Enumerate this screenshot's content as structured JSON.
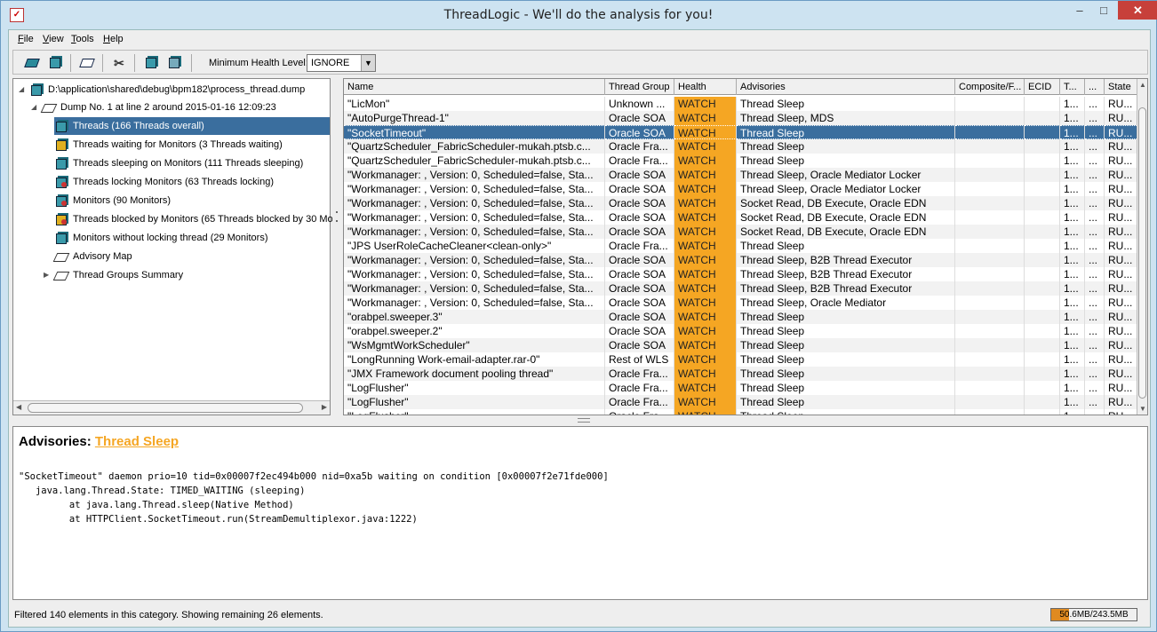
{
  "window": {
    "title": "ThreadLogic - We'll do the analysis for you!",
    "icon": "app-icon",
    "min": "‒",
    "max": "□",
    "close": "✕"
  },
  "menu": [
    {
      "label": "File",
      "u": "F",
      "rest": "ile"
    },
    {
      "label": "View",
      "u": "V",
      "rest": "iew"
    },
    {
      "label": "Tools",
      "u": "T",
      "rest": "ools"
    },
    {
      "label": "Help",
      "u": "H",
      "rest": "elp"
    }
  ],
  "toolbar": {
    "health_label": "Minimum Health Level:",
    "health_value": "IGNORE",
    "buttons": [
      "open-dump-icon",
      "open-cube-icon",
      "diamond-icon",
      "tools-icon",
      "cube-a-icon",
      "cube-b-icon"
    ]
  },
  "tree": {
    "root": "D:\\application\\shared\\debug\\bpm182\\process_thread.dump",
    "dump": "Dump No. 1 at line 2 around 2015-01-16 12:09:23",
    "items": [
      {
        "label": "Threads (166 Threads overall)",
        "selected": true
      },
      {
        "label": "Threads waiting for Monitors (3 Threads waiting)"
      },
      {
        "label": "Threads sleeping on Monitors (111 Threads sleeping)"
      },
      {
        "label": "Threads locking Monitors (63 Threads locking)"
      },
      {
        "label": "Monitors (90 Monitors)"
      },
      {
        "label": "Threads blocked by Monitors (65 Threads blocked by 30 Mo"
      },
      {
        "label": "Monitors without locking thread (29 Monitors)"
      },
      {
        "label": "Advisory Map"
      },
      {
        "label": "Thread Groups Summary"
      }
    ]
  },
  "table": {
    "columns": [
      "Name",
      "Thread Group",
      "Health",
      "Advisories",
      "Composite/F...",
      "ECID",
      "T...",
      "...",
      "State"
    ],
    "rows": [
      {
        "name": "\"LicMon\"",
        "group": "Unknown ...",
        "health": "WATCH",
        "adv": "Thread Sleep",
        "t": "1...",
        "dots": "...",
        "state": "RU..."
      },
      {
        "name": "\"AutoPurgeThread-1\"",
        "group": "Oracle SOA",
        "health": "WATCH",
        "adv": "Thread Sleep, MDS",
        "t": "1...",
        "dots": "...",
        "state": "RU..."
      },
      {
        "name": "\"SocketTimeout\"",
        "group": "Oracle SOA",
        "health": "WATCH",
        "adv": "Thread Sleep",
        "t": "1...",
        "dots": "...",
        "state": "RU...",
        "selected": true
      },
      {
        "name": "\"QuartzScheduler_FabricScheduler-mukah.ptsb.c...",
        "group": "Oracle Fra...",
        "health": "WATCH",
        "adv": "Thread Sleep",
        "t": "1...",
        "dots": "...",
        "state": "RU..."
      },
      {
        "name": "\"QuartzScheduler_FabricScheduler-mukah.ptsb.c...",
        "group": "Oracle Fra...",
        "health": "WATCH",
        "adv": "Thread Sleep",
        "t": "1...",
        "dots": "...",
        "state": "RU..."
      },
      {
        "name": "\"Workmanager: , Version: 0, Scheduled=false, Sta...",
        "group": "Oracle SOA",
        "health": "WATCH",
        "adv": "Thread Sleep, Oracle Mediator Locker",
        "t": "1...",
        "dots": "...",
        "state": "RU..."
      },
      {
        "name": "\"Workmanager: , Version: 0, Scheduled=false, Sta...",
        "group": "Oracle SOA",
        "health": "WATCH",
        "adv": "Thread Sleep, Oracle Mediator Locker",
        "t": "1...",
        "dots": "...",
        "state": "RU..."
      },
      {
        "name": "\"Workmanager: , Version: 0, Scheduled=false, Sta...",
        "group": "Oracle SOA",
        "health": "WATCH",
        "adv": "Socket Read, DB Execute, Oracle EDN",
        "t": "1...",
        "dots": "...",
        "state": "RU..."
      },
      {
        "name": "\"Workmanager: , Version: 0, Scheduled=false, Sta...",
        "group": "Oracle SOA",
        "health": "WATCH",
        "adv": "Socket Read, DB Execute, Oracle EDN",
        "t": "1...",
        "dots": "...",
        "state": "RU..."
      },
      {
        "name": "\"Workmanager: , Version: 0, Scheduled=false, Sta...",
        "group": "Oracle SOA",
        "health": "WATCH",
        "adv": "Socket Read, DB Execute, Oracle EDN",
        "t": "1...",
        "dots": "...",
        "state": "RU..."
      },
      {
        "name": "\"JPS UserRoleCacheCleaner<clean-only>\"",
        "group": "Oracle Fra...",
        "health": "WATCH",
        "adv": "Thread Sleep",
        "t": "1...",
        "dots": "...",
        "state": "RU..."
      },
      {
        "name": "\"Workmanager: , Version: 0, Scheduled=false, Sta...",
        "group": "Oracle SOA",
        "health": "WATCH",
        "adv": "Thread Sleep, B2B Thread Executor",
        "t": "1...",
        "dots": "...",
        "state": "RU..."
      },
      {
        "name": "\"Workmanager: , Version: 0, Scheduled=false, Sta...",
        "group": "Oracle SOA",
        "health": "WATCH",
        "adv": "Thread Sleep, B2B Thread Executor",
        "t": "1...",
        "dots": "...",
        "state": "RU..."
      },
      {
        "name": "\"Workmanager: , Version: 0, Scheduled=false, Sta...",
        "group": "Oracle SOA",
        "health": "WATCH",
        "adv": "Thread Sleep, B2B Thread Executor",
        "t": "1...",
        "dots": "...",
        "state": "RU..."
      },
      {
        "name": "\"Workmanager: , Version: 0, Scheduled=false, Sta...",
        "group": "Oracle SOA",
        "health": "WATCH",
        "adv": "Thread Sleep, Oracle Mediator",
        "t": "1...",
        "dots": "...",
        "state": "RU..."
      },
      {
        "name": "\"orabpel.sweeper.3\"",
        "group": "Oracle SOA",
        "health": "WATCH",
        "adv": "Thread Sleep",
        "t": "1...",
        "dots": "...",
        "state": "RU..."
      },
      {
        "name": "\"orabpel.sweeper.2\"",
        "group": "Oracle SOA",
        "health": "WATCH",
        "adv": "Thread Sleep",
        "t": "1...",
        "dots": "...",
        "state": "RU..."
      },
      {
        "name": "\"WsMgmtWorkScheduler\"",
        "group": "Oracle SOA",
        "health": "WATCH",
        "adv": "Thread Sleep",
        "t": "1...",
        "dots": "...",
        "state": "RU..."
      },
      {
        "name": "\"LongRunning Work-email-adapter.rar-0\"",
        "group": "Rest of WLS",
        "health": "WATCH",
        "adv": "Thread Sleep",
        "t": "1...",
        "dots": "...",
        "state": "RU..."
      },
      {
        "name": "\"JMX Framework document pooling thread\"",
        "group": "Oracle Fra...",
        "health": "WATCH",
        "adv": "Thread Sleep",
        "t": "1...",
        "dots": "...",
        "state": "RU..."
      },
      {
        "name": "\"LogFlusher\"",
        "group": "Oracle Fra...",
        "health": "WATCH",
        "adv": "Thread Sleep",
        "t": "1...",
        "dots": "...",
        "state": "RU..."
      },
      {
        "name": "\"LogFlusher\"",
        "group": "Oracle Fra...",
        "health": "WATCH",
        "adv": "Thread Sleep",
        "t": "1...",
        "dots": "...",
        "state": "RU..."
      },
      {
        "name": "\"LogFlusher\"",
        "group": "Oracle Fra...",
        "health": "WATCH",
        "adv": "Thread Sleep",
        "t": "1...",
        "dots": "...",
        "state": "RU..."
      }
    ]
  },
  "detail": {
    "advisories_label": "Advisories:",
    "advisory_link": "Thread Sleep",
    "stack": "\"SocketTimeout\" daemon prio=10 tid=0x00007f2ec494b000 nid=0xa5b waiting on condition [0x00007f2e71fde000]\n   java.lang.Thread.State: TIMED_WAITING (sleeping)\n         at java.lang.Thread.sleep(Native Method)\n         at HTTPClient.SocketTimeout.run(StreamDemultiplexor.java:1222)"
  },
  "status": {
    "text": "Filtered 140 elements in this category. Showing remaining 26 elements.",
    "memory": "50.6MB/243.5MB",
    "memory_fraction": 0.21
  },
  "colors": {
    "watch": "#f5a623",
    "selection": "#3a6e9e"
  }
}
